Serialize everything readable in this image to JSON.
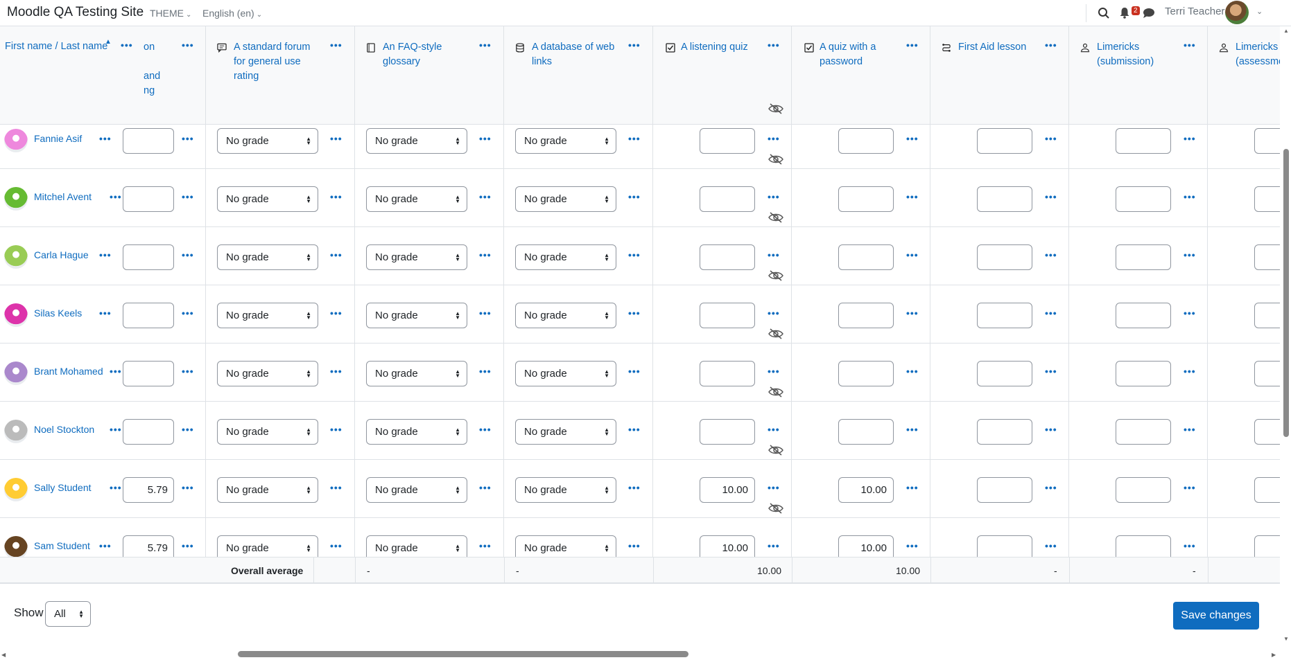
{
  "navbar": {
    "site_name": "Moodle QA Testing Site",
    "theme_label": "THEME",
    "language_label": "English (en)",
    "notification_count": "2",
    "user_name": "Terri Teacher"
  },
  "columns": [
    {
      "key": "name",
      "title": "First name / Last name",
      "sort_icon": "sort-ascending-icon"
    },
    {
      "key": "c1",
      "title_lines": [
        "on",
        "",
        "and",
        "ng"
      ],
      "icon": ""
    },
    {
      "key": "c2",
      "title": "A standard forum for general use rating",
      "icon": "forum-icon"
    },
    {
      "key": "c3",
      "title": "An FAQ-style glossary",
      "icon": "glossary-icon"
    },
    {
      "key": "c4",
      "title": "A database of web links",
      "icon": "database-icon"
    },
    {
      "key": "c5",
      "title": "A listening quiz",
      "icon": "quiz-icon",
      "hidden": true
    },
    {
      "key": "c6",
      "title": "A quiz with a password",
      "icon": "quiz-icon"
    },
    {
      "key": "c7",
      "title": "First Aid lesson",
      "icon": "lesson-icon"
    },
    {
      "key": "c8",
      "title": "Limericks (submission)",
      "icon": "workshop-icon"
    },
    {
      "key": "c9",
      "title": "Limericks (assessmen",
      "icon": "workshop-icon"
    }
  ],
  "no_grade_label": "No grade",
  "students": [
    {
      "name": "Fannie Asif",
      "c1": "",
      "c5": "",
      "c6": "",
      "avatar": "#e8d"
    },
    {
      "name": "Mitchel Avent",
      "c1": "",
      "c5": "",
      "c6": "",
      "avatar": "#6b3"
    },
    {
      "name": "Carla Hague",
      "c1": "",
      "c5": "",
      "c6": "",
      "avatar": "#9c5"
    },
    {
      "name": "Silas Keels",
      "c1": "",
      "c5": "",
      "c6": "",
      "avatar": "#d3a"
    },
    {
      "name": "Brant Mohamed",
      "c1": "",
      "c5": "",
      "c6": "",
      "avatar": "#a8c"
    },
    {
      "name": "Noel Stockton",
      "c1": "",
      "c5": "",
      "c6": "",
      "avatar": "#bbb"
    },
    {
      "name": "Sally Student",
      "c1": "5.79",
      "c5": "10.00",
      "c6": "10.00",
      "avatar": "#fc3"
    },
    {
      "name": "Sam Student",
      "c1": "5.79",
      "c5": "10.00",
      "c6": "10.00",
      "avatar": "#642"
    }
  ],
  "averages": {
    "label": "Overall average",
    "c3": "-",
    "c4": "-",
    "c5": "10.00",
    "c6": "10.00",
    "c7": "-",
    "c8": "-"
  },
  "footer": {
    "show_label": "Show",
    "show_value": "All",
    "save_label": "Save changes"
  }
}
